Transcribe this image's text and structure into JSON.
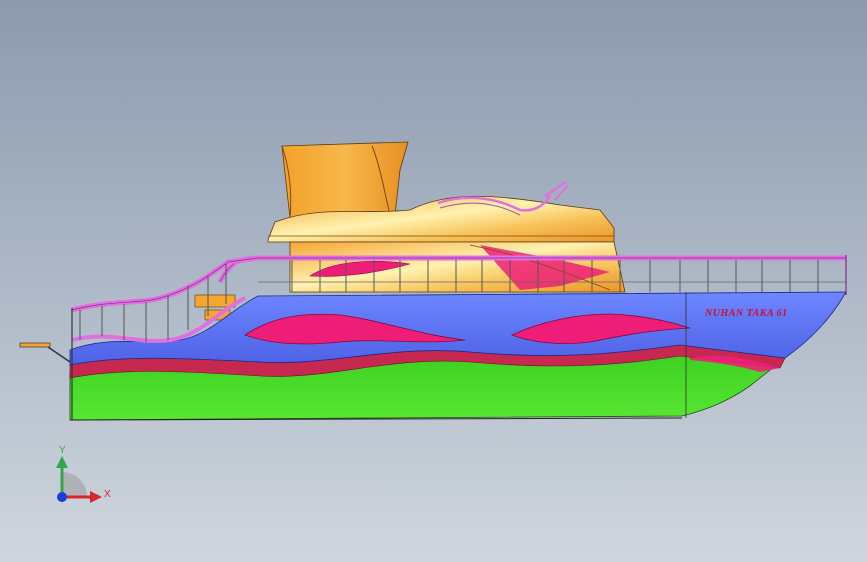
{
  "model": {
    "hull_name": "NUHAN TAKA 61"
  },
  "triad": {
    "x_label": "X",
    "y_label": "Y"
  },
  "colors": {
    "hull_blue": "#5b72f0",
    "hull_green": "#46d62a",
    "stripe_red": "#c7284f",
    "flame_pink": "#ee1e78",
    "rail_magenta": "#e070e0",
    "cabin_orange": "#f6a531",
    "axis_x": "#d9262a",
    "axis_y": "#2ea84a",
    "axis_z": "#1b3fd6"
  }
}
